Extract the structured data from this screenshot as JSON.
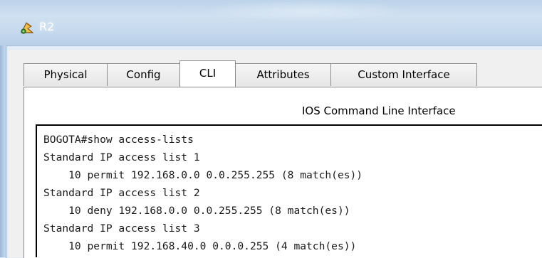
{
  "window": {
    "title": "R2",
    "icon": "router-device-icon"
  },
  "tabs": [
    {
      "label": "Physical",
      "active": false
    },
    {
      "label": "Config",
      "active": false
    },
    {
      "label": "CLI",
      "active": true
    },
    {
      "label": "Attributes",
      "active": false
    },
    {
      "label": "Custom Interface",
      "active": false
    }
  ],
  "cli": {
    "heading": "IOS Command Line Interface",
    "lines": [
      "BOGOTA#show access-lists",
      "Standard IP access list 1",
      "    10 permit 192.168.0.0 0.0.255.255 (8 match(es))",
      "Standard IP access list 2",
      "    10 deny 192.168.0.0 0.0.255.255 (8 match(es))",
      "Standard IP access list 3",
      "    10 permit 192.168.40.0 0.0.0.255 (4 match(es))"
    ]
  },
  "colors": {
    "titlebar": "#c6daee",
    "terminal_text": "#1a1a1a",
    "terminal_border": "#000000"
  }
}
